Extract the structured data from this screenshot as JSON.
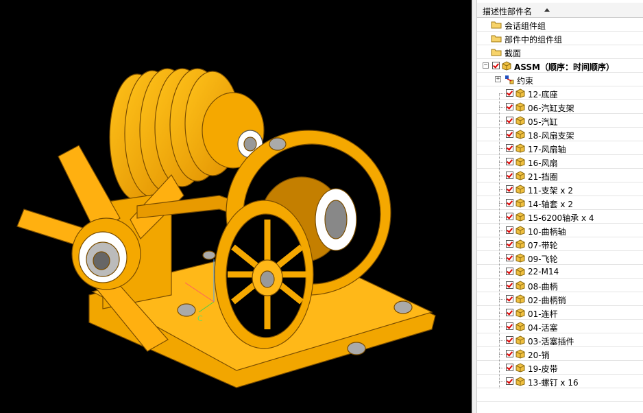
{
  "colors": {
    "part": "#f5a800",
    "part_dark": "#c47f00",
    "background": "#000000",
    "check": "#dd0000"
  },
  "tree": {
    "header": "描述性部件名",
    "folders": [
      {
        "label": "会话组件组",
        "icon": "folder-icon"
      },
      {
        "label": "部件中的组件组",
        "icon": "folder-icon"
      },
      {
        "label": "截面",
        "icon": "folder-icon"
      }
    ],
    "root": {
      "label": "ASSM（顺序：时间顺序）",
      "expander": "−"
    },
    "constraints": {
      "label": "约束",
      "expander": "+"
    },
    "components": [
      "12-底座",
      "06-汽缸支架",
      "05-汽缸",
      "18-风扇支架",
      "17-风扇轴",
      "16-风扇",
      "21-挡圈",
      "11-支架 x 2",
      "14-轴套 x 2",
      "15-6200轴承 x 4",
      "10-曲柄轴",
      "07-带轮",
      "09-飞轮",
      "22-M14",
      "08-曲柄",
      "02-曲柄销",
      "01-连杆",
      "04-活塞",
      "03-活塞插件",
      "20-销",
      "19-皮带",
      "13-螺钉 x 16"
    ]
  },
  "viewport": {
    "triad_label": "C"
  }
}
